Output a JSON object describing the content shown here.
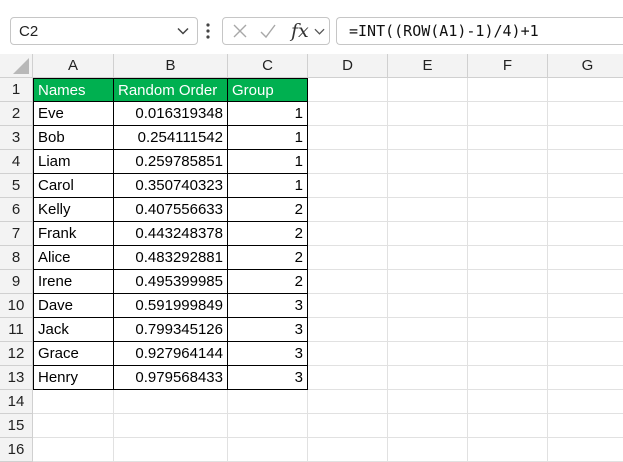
{
  "name_box": {
    "value": "C2"
  },
  "formula_bar": {
    "value": "=INT((ROW(A1)-1)/4)+1"
  },
  "columns": [
    "A",
    "B",
    "C",
    "D",
    "E",
    "F",
    "G"
  ],
  "rows": [
    "1",
    "2",
    "3",
    "4",
    "5",
    "6",
    "7",
    "8",
    "9",
    "10",
    "11",
    "12",
    "13",
    "14",
    "15",
    "16"
  ],
  "header_fill_color": "#00b050",
  "table": {
    "headers": [
      "Names",
      "Random Order",
      "Group"
    ],
    "data": [
      [
        "Eve",
        "0.016319348",
        "1"
      ],
      [
        "Bob",
        "0.254111542",
        "1"
      ],
      [
        "Liam",
        "0.259785851",
        "1"
      ],
      [
        "Carol",
        "0.350740323",
        "1"
      ],
      [
        "Kelly",
        "0.407556633",
        "2"
      ],
      [
        "Frank",
        "0.443248378",
        "2"
      ],
      [
        "Alice",
        "0.483292881",
        "2"
      ],
      [
        "Irene",
        "0.495399985",
        "2"
      ],
      [
        "Dave",
        "0.591999849",
        "3"
      ],
      [
        "Jack",
        "0.799345126",
        "3"
      ],
      [
        "Grace",
        "0.927964144",
        "3"
      ],
      [
        "Henry",
        "0.979568433",
        "3"
      ]
    ]
  },
  "icons": [
    "chevron-down-icon",
    "more-options-icon",
    "cancel-icon",
    "confirm-icon",
    "insert-function-icon",
    "select-all-icon"
  ]
}
